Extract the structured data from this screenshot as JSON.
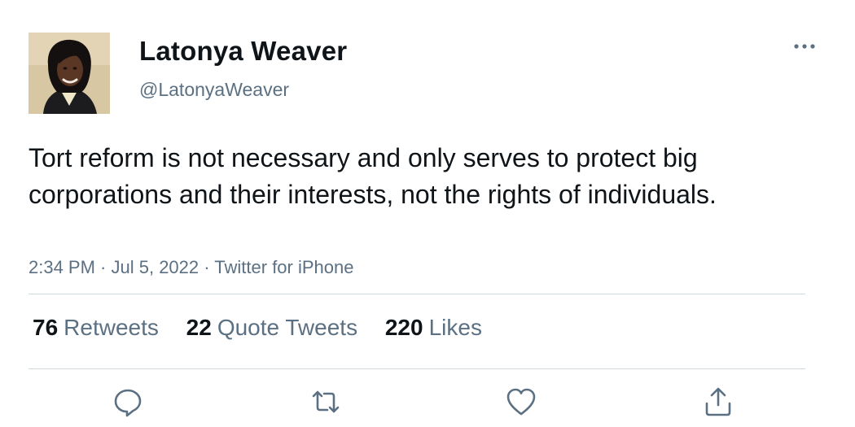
{
  "user": {
    "display_name": "Latonya Weaver",
    "handle": "@LatonyaWeaver"
  },
  "tweet": {
    "text": "Tort reform is not necessary and only serves to protect big corporations and their interests, not the rights of individuals.",
    "time": "2:34 PM",
    "date": "Jul 5, 2022",
    "source": "Twitter for iPhone",
    "separator": " · "
  },
  "stats": {
    "retweets_count": "76",
    "retweets_label": "Retweets",
    "quotes_count": "22",
    "quotes_label": "Quote Tweets",
    "likes_count": "220",
    "likes_label": "Likes"
  },
  "icons": {
    "more": "more-horizontal-icon",
    "reply": "reply-icon",
    "retweet": "retweet-icon",
    "like": "heart-icon",
    "share": "share-icon"
  },
  "colors": {
    "text_primary": "#0f1419",
    "text_secondary": "#5b7083",
    "divider": "#cfd9de"
  }
}
